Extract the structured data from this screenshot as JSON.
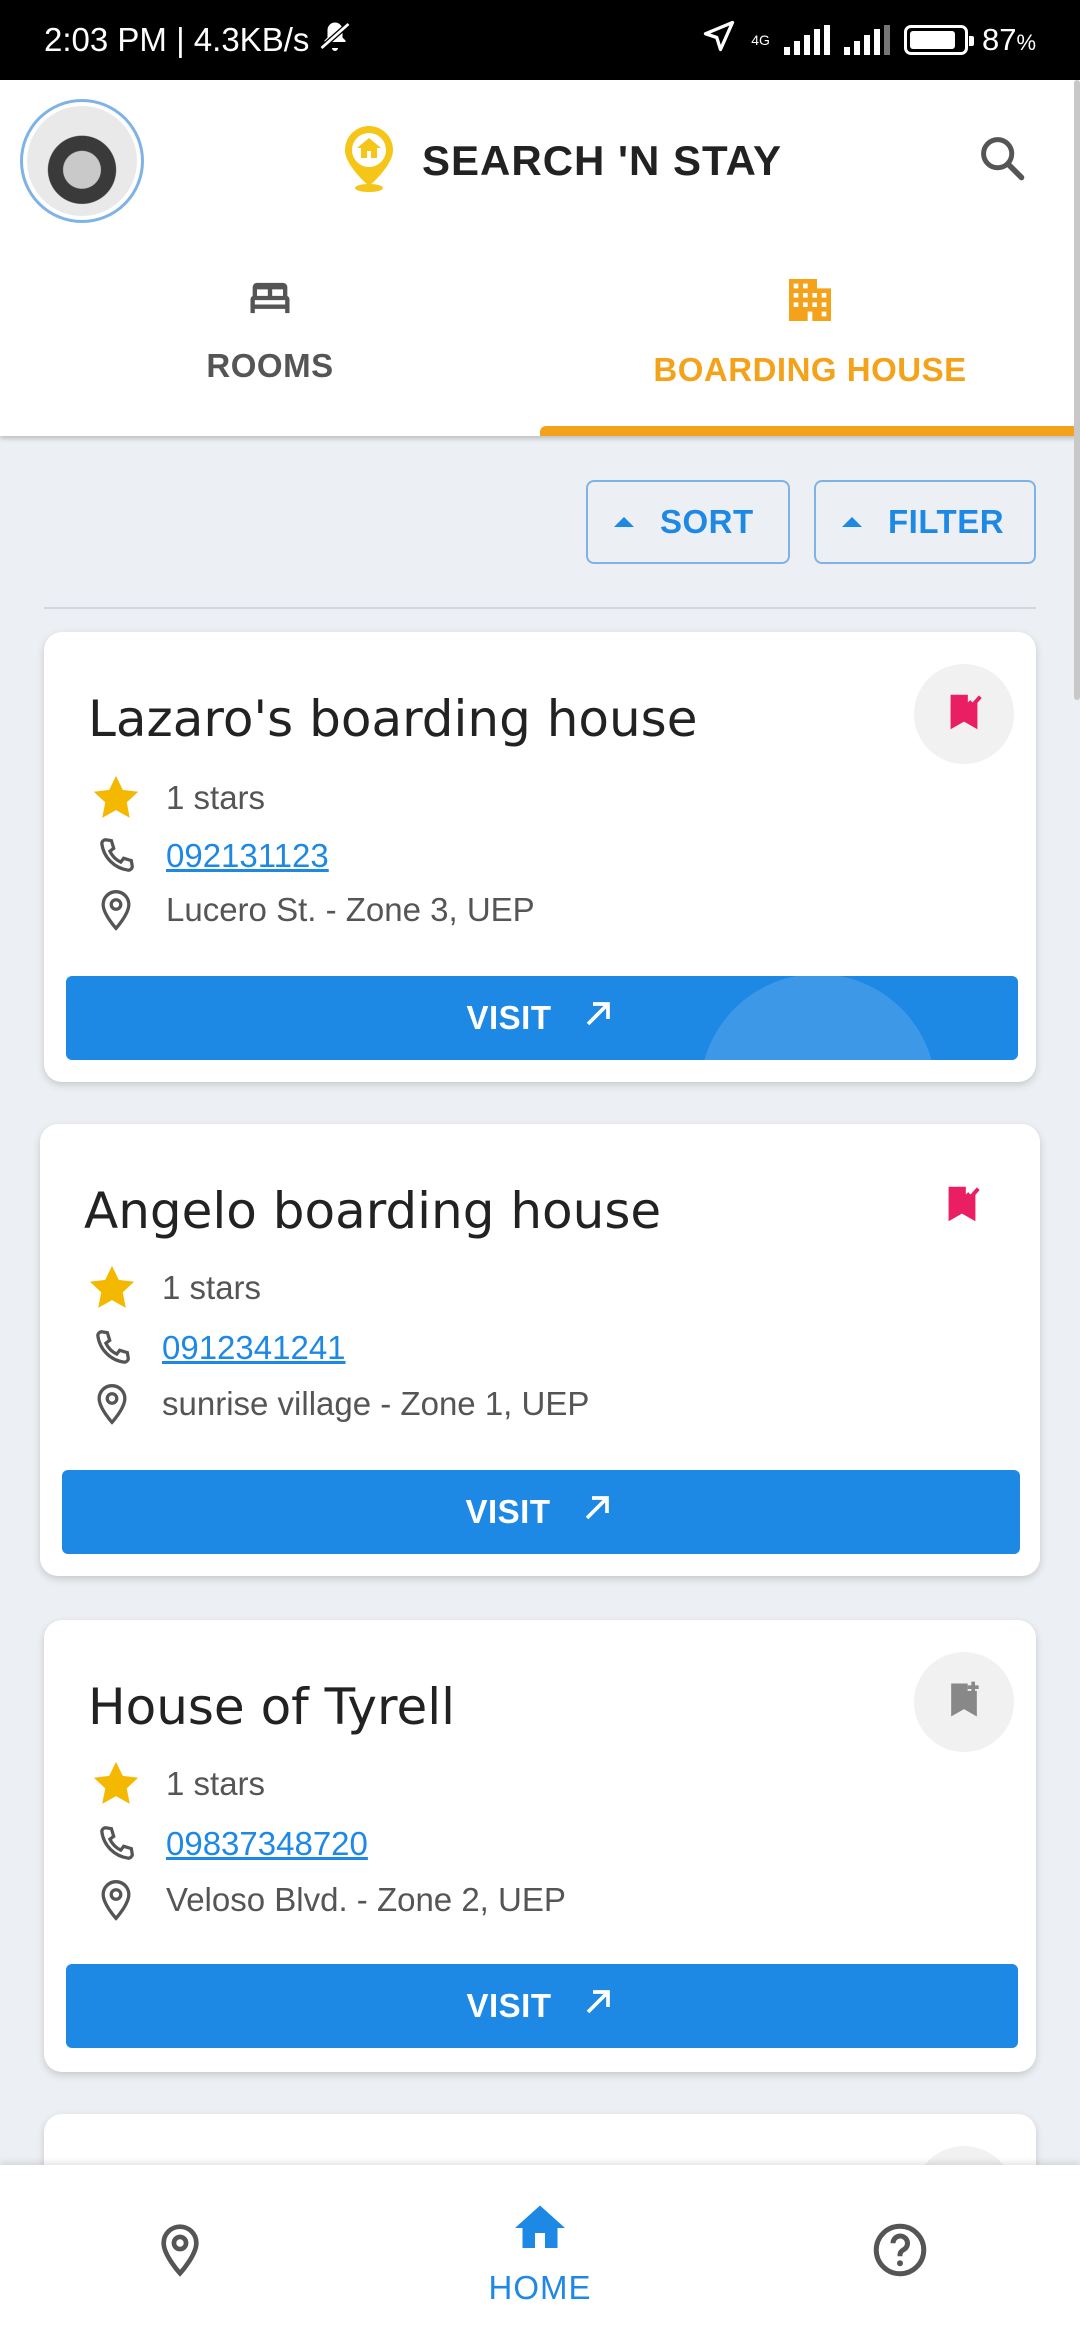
{
  "status_bar": {
    "time_speed": "2:03 PM | 4.3KB/s",
    "network": "4G",
    "battery": "87",
    "battery_unit": "%"
  },
  "header": {
    "app_title": "SEARCH 'N STAY",
    "avatar_icon": "user-photo",
    "logo_icon": "house-pin-icon",
    "search_icon": "search-icon",
    "brand_color": "#f5c518"
  },
  "tabs": [
    {
      "label": "ROOMS",
      "icon": "bed-icon",
      "active": false
    },
    {
      "label": "BOARDING HOUSE",
      "icon": "building-icon",
      "active": true
    }
  ],
  "controls": {
    "sort_label": "SORT",
    "filter_label": "FILTER"
  },
  "listings": [
    {
      "name": "Lazaro's boarding house",
      "rating": "1 stars",
      "phone": "092131123",
      "address": "Lucero St. - Zone 3, UEP",
      "visit_label": "VISIT",
      "bookmark": "bookmark-saved-icon"
    },
    {
      "name": "Angelo boarding house",
      "rating": "1 stars",
      "phone": "0912341241",
      "address": "sunrise village - Zone 1, UEP",
      "visit_label": "VISIT",
      "bookmark": "bookmark-saved-icon"
    },
    {
      "name": "House of Tyrell",
      "rating": "1 stars",
      "phone": "09837348720",
      "address": "Veloso Blvd. - Zone 2, UEP",
      "visit_label": "VISIT",
      "bookmark": "bookmark-add-icon"
    }
  ],
  "bottom_nav": {
    "items": [
      {
        "icon": "map-pin-icon",
        "label": ""
      },
      {
        "icon": "home-icon",
        "label": "HOME"
      },
      {
        "icon": "help-icon",
        "label": ""
      }
    ]
  },
  "colors": {
    "accent_orange": "#f5a21b",
    "primary_blue": "#1e88e5",
    "bookmark_pink": "#e91e63",
    "star_yellow": "#f5b800"
  }
}
